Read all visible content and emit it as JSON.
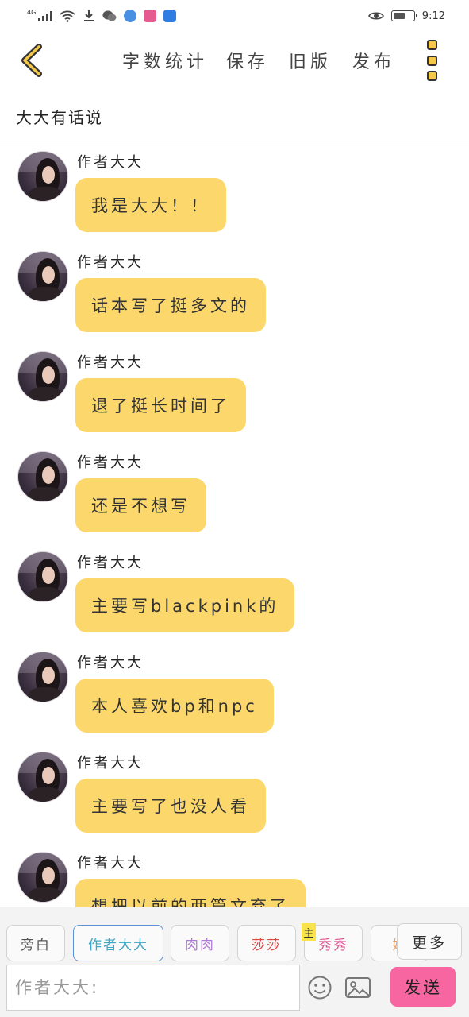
{
  "status_bar": {
    "network": "4G",
    "time": "9:12",
    "battery_level": 0.5
  },
  "toolbar": {
    "word_count": "字数统计",
    "save": "保存",
    "old_version": "旧版",
    "publish": "发布"
  },
  "chat": {
    "title": "大大有话说",
    "messages": [
      {
        "sender": "作者大大",
        "text": "我是大大！！"
      },
      {
        "sender": "作者大大",
        "text": "话本写了挺多文的"
      },
      {
        "sender": "作者大大",
        "text": "退了挺长时间了"
      },
      {
        "sender": "作者大大",
        "text": "还是不想写"
      },
      {
        "sender": "作者大大",
        "text": "主要写blackpink的"
      },
      {
        "sender": "作者大大",
        "text": "本人喜欢bp和npc"
      },
      {
        "sender": "作者大大",
        "text": "主要写了也没人看"
      },
      {
        "sender": "作者大大",
        "text": "想把以前的两篇文弃了"
      }
    ]
  },
  "roles": {
    "items": [
      {
        "label": "旁白",
        "color": "#555555"
      },
      {
        "label": "作者大大",
        "color": "#3ba6c9"
      },
      {
        "label": "肉肉",
        "color": "#b07bd6"
      },
      {
        "label": "莎莎",
        "color": "#e04848"
      },
      {
        "label": "秀秀",
        "color": "#d9558f"
      },
      {
        "label": "妮",
        "color": "#f0a060"
      }
    ],
    "main_tag": "主",
    "more": "更多"
  },
  "composer": {
    "placeholder": "作者大大:",
    "send": "发送"
  },
  "colors": {
    "bubble": "#fcd86c",
    "accent_yellow": "#f4c84a",
    "send_button": "#f766a0",
    "active_role_border": "#5b8fd6"
  }
}
